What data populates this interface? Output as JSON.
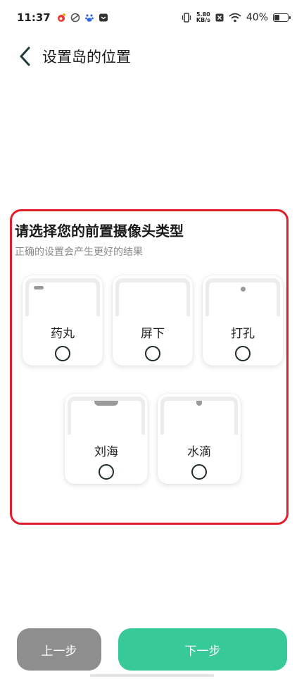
{
  "status_bar": {
    "time": "11:37",
    "speed_value": "5.80",
    "speed_unit": "KB/s",
    "battery_percent": "40%",
    "battery_level": 0.4
  },
  "header": {
    "title": "设置岛的位置"
  },
  "panel": {
    "title": "请选择您的前置摄像头类型",
    "subtitle": "正确的设置会产生更好的结果",
    "options": [
      {
        "label": "药丸",
        "selected": false
      },
      {
        "label": "屏下",
        "selected": false
      },
      {
        "label": "打孔",
        "selected": false
      },
      {
        "label": "刘海",
        "selected": false
      },
      {
        "label": "水滴",
        "selected": false
      }
    ]
  },
  "footer": {
    "prev_label": "上一步",
    "next_label": "下一步"
  },
  "colors": {
    "accent": "#37c998",
    "prev_button": "#8e8e8e",
    "highlight_border": "#e01e2b"
  }
}
